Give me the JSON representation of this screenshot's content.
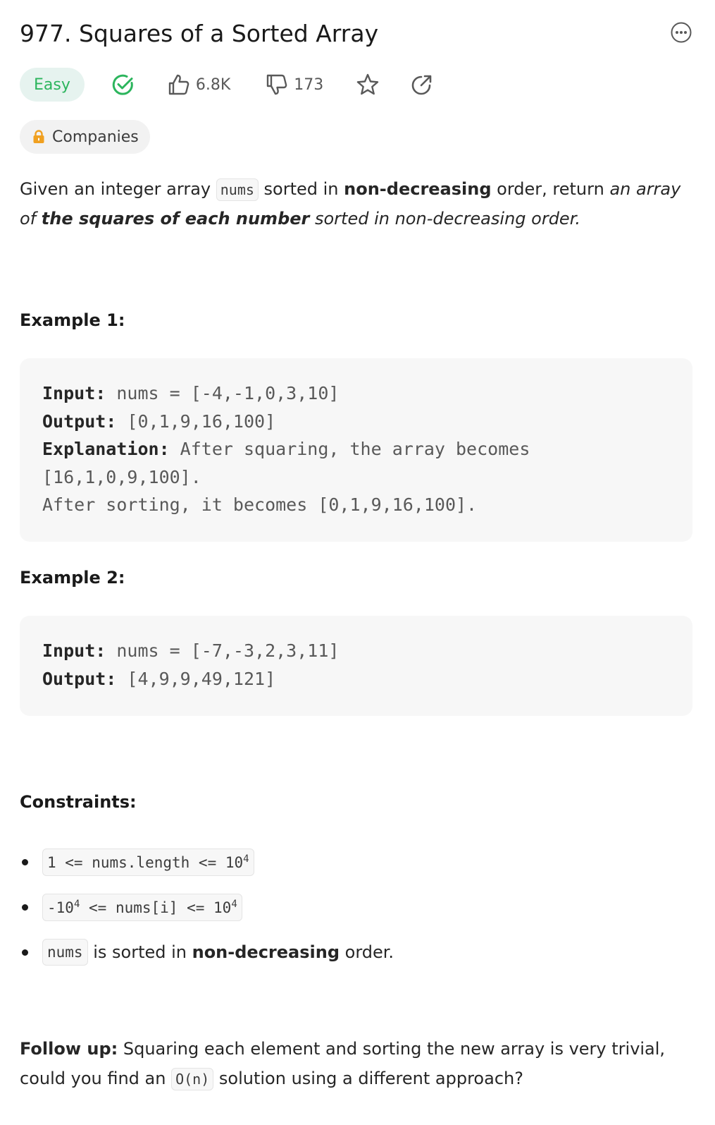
{
  "problem": {
    "title": "977. Squares of a Sorted Array",
    "difficulty": "Easy",
    "likes": "6.8K",
    "dislikes": "173",
    "companies_label": "Companies"
  },
  "description": {
    "p1": "Given an integer array ",
    "code_nums": "nums",
    "p2": " sorted in ",
    "bold1": "non-decreasing",
    "p3": " order, return ",
    "ital1": "an array of ",
    "boldital": "the squares of each number",
    "ital2": " sorted in non-decreasing order."
  },
  "example1": {
    "heading": "Example 1:",
    "input_label": "Input:",
    "input_value": " nums = [-4,-1,0,3,10]",
    "output_label": "Output:",
    "output_value": " [0,1,9,16,100]",
    "explanation_label": "Explanation:",
    "explanation_line1": " After squaring, the array becomes",
    "explanation_line2": "[16,1,0,9,100].",
    "explanation_line3": "After sorting, it becomes [0,1,9,16,100]."
  },
  "example2": {
    "heading": "Example 2:",
    "input_label": "Input:",
    "input_value": " nums = [-7,-3,2,3,11]",
    "output_label": "Output:",
    "output_value": " [4,9,9,49,121]"
  },
  "constraints": {
    "heading": "Constraints:",
    "c1_code": "1 <= nums.length <= 10",
    "c1_sup": "4",
    "c2_code_a": "-10",
    "c2_sup_a": "4",
    "c2_code_b": " <= nums[i] <= 10",
    "c2_sup_b": "4",
    "c3_code": "nums",
    "c3_text": " is sorted in ",
    "c3_bold": "non-decreasing",
    "c3_tail": " order."
  },
  "follow_up": {
    "label": "Follow up:",
    "text1": " Squaring each element and sorting the new array is very trivial, could you find an ",
    "code": "O(n)",
    "text2": " solution using a different approach?"
  },
  "colors": {
    "easy_text": "#2cb55d",
    "easy_bg": "#e6f3ef",
    "solved_check": "#2cb55d",
    "lock": "#f0a020",
    "code_bg": "#f7f7f7"
  },
  "icons": [
    "more-icon",
    "solved-check-icon",
    "thumbs-up-icon",
    "thumbs-down-icon",
    "star-icon",
    "share-icon",
    "lock-icon"
  ]
}
